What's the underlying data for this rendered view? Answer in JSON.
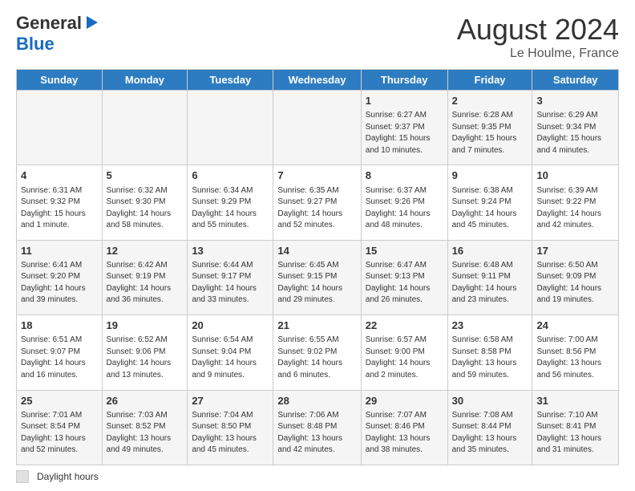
{
  "header": {
    "logo_general": "General",
    "logo_blue": "Blue",
    "title": "August 2024",
    "location": "Le Houlme, France"
  },
  "weekdays": [
    "Sunday",
    "Monday",
    "Tuesday",
    "Wednesday",
    "Thursday",
    "Friday",
    "Saturday"
  ],
  "footer": {
    "label": "Daylight hours"
  },
  "weeks": [
    [
      {
        "day": "",
        "info": ""
      },
      {
        "day": "",
        "info": ""
      },
      {
        "day": "",
        "info": ""
      },
      {
        "day": "",
        "info": ""
      },
      {
        "day": "1",
        "info": "Sunrise: 6:27 AM\nSunset: 9:37 PM\nDaylight: 15 hours\nand 10 minutes."
      },
      {
        "day": "2",
        "info": "Sunrise: 6:28 AM\nSunset: 9:35 PM\nDaylight: 15 hours\nand 7 minutes."
      },
      {
        "day": "3",
        "info": "Sunrise: 6:29 AM\nSunset: 9:34 PM\nDaylight: 15 hours\nand 4 minutes."
      }
    ],
    [
      {
        "day": "4",
        "info": "Sunrise: 6:31 AM\nSunset: 9:32 PM\nDaylight: 15 hours\nand 1 minute."
      },
      {
        "day": "5",
        "info": "Sunrise: 6:32 AM\nSunset: 9:30 PM\nDaylight: 14 hours\nand 58 minutes."
      },
      {
        "day": "6",
        "info": "Sunrise: 6:34 AM\nSunset: 9:29 PM\nDaylight: 14 hours\nand 55 minutes."
      },
      {
        "day": "7",
        "info": "Sunrise: 6:35 AM\nSunset: 9:27 PM\nDaylight: 14 hours\nand 52 minutes."
      },
      {
        "day": "8",
        "info": "Sunrise: 6:37 AM\nSunset: 9:26 PM\nDaylight: 14 hours\nand 48 minutes."
      },
      {
        "day": "9",
        "info": "Sunrise: 6:38 AM\nSunset: 9:24 PM\nDaylight: 14 hours\nand 45 minutes."
      },
      {
        "day": "10",
        "info": "Sunrise: 6:39 AM\nSunset: 9:22 PM\nDaylight: 14 hours\nand 42 minutes."
      }
    ],
    [
      {
        "day": "11",
        "info": "Sunrise: 6:41 AM\nSunset: 9:20 PM\nDaylight: 14 hours\nand 39 minutes."
      },
      {
        "day": "12",
        "info": "Sunrise: 6:42 AM\nSunset: 9:19 PM\nDaylight: 14 hours\nand 36 minutes."
      },
      {
        "day": "13",
        "info": "Sunrise: 6:44 AM\nSunset: 9:17 PM\nDaylight: 14 hours\nand 33 minutes."
      },
      {
        "day": "14",
        "info": "Sunrise: 6:45 AM\nSunset: 9:15 PM\nDaylight: 14 hours\nand 29 minutes."
      },
      {
        "day": "15",
        "info": "Sunrise: 6:47 AM\nSunset: 9:13 PM\nDaylight: 14 hours\nand 26 minutes."
      },
      {
        "day": "16",
        "info": "Sunrise: 6:48 AM\nSunset: 9:11 PM\nDaylight: 14 hours\nand 23 minutes."
      },
      {
        "day": "17",
        "info": "Sunrise: 6:50 AM\nSunset: 9:09 PM\nDaylight: 14 hours\nand 19 minutes."
      }
    ],
    [
      {
        "day": "18",
        "info": "Sunrise: 6:51 AM\nSunset: 9:07 PM\nDaylight: 14 hours\nand 16 minutes."
      },
      {
        "day": "19",
        "info": "Sunrise: 6:52 AM\nSunset: 9:06 PM\nDaylight: 14 hours\nand 13 minutes."
      },
      {
        "day": "20",
        "info": "Sunrise: 6:54 AM\nSunset: 9:04 PM\nDaylight: 14 hours\nand 9 minutes."
      },
      {
        "day": "21",
        "info": "Sunrise: 6:55 AM\nSunset: 9:02 PM\nDaylight: 14 hours\nand 6 minutes."
      },
      {
        "day": "22",
        "info": "Sunrise: 6:57 AM\nSunset: 9:00 PM\nDaylight: 14 hours\nand 2 minutes."
      },
      {
        "day": "23",
        "info": "Sunrise: 6:58 AM\nSunset: 8:58 PM\nDaylight: 13 hours\nand 59 minutes."
      },
      {
        "day": "24",
        "info": "Sunrise: 7:00 AM\nSunset: 8:56 PM\nDaylight: 13 hours\nand 56 minutes."
      }
    ],
    [
      {
        "day": "25",
        "info": "Sunrise: 7:01 AM\nSunset: 8:54 PM\nDaylight: 13 hours\nand 52 minutes."
      },
      {
        "day": "26",
        "info": "Sunrise: 7:03 AM\nSunset: 8:52 PM\nDaylight: 13 hours\nand 49 minutes."
      },
      {
        "day": "27",
        "info": "Sunrise: 7:04 AM\nSunset: 8:50 PM\nDaylight: 13 hours\nand 45 minutes."
      },
      {
        "day": "28",
        "info": "Sunrise: 7:06 AM\nSunset: 8:48 PM\nDaylight: 13 hours\nand 42 minutes."
      },
      {
        "day": "29",
        "info": "Sunrise: 7:07 AM\nSunset: 8:46 PM\nDaylight: 13 hours\nand 38 minutes."
      },
      {
        "day": "30",
        "info": "Sunrise: 7:08 AM\nSunset: 8:44 PM\nDaylight: 13 hours\nand 35 minutes."
      },
      {
        "day": "31",
        "info": "Sunrise: 7:10 AM\nSunset: 8:41 PM\nDaylight: 13 hours\nand 31 minutes."
      }
    ]
  ]
}
